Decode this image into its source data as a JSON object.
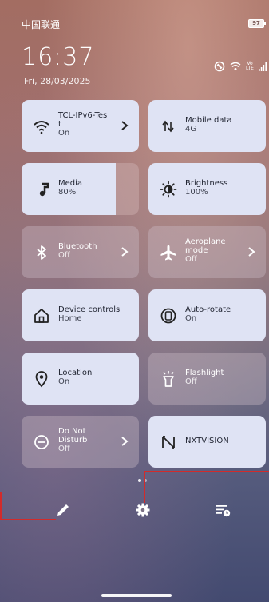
{
  "status_bar": {
    "carrier": "中国联通",
    "battery": "97",
    "volte_label_top": "Vo",
    "volte_label_bottom": "LTE"
  },
  "lockscreen": {
    "time": "16:37",
    "date": "Fri, 28/03/2025"
  },
  "tiles": [
    {
      "id": "wifi",
      "label": "TCL-IPv6-Tes\nt",
      "status": "On",
      "state": "on",
      "icon": "wifi-icon",
      "has_chevron": true
    },
    {
      "id": "mobile-data",
      "label": "Mobile data",
      "status": "4G",
      "state": "on",
      "icon": "mobile-data-icon",
      "has_chevron": false
    },
    {
      "id": "media",
      "label": "Media",
      "status": "80%",
      "state": "slider",
      "icon": "music-note-icon",
      "level": 0.8
    },
    {
      "id": "brightness",
      "label": "Brightness",
      "status": "100%",
      "state": "on",
      "icon": "brightness-icon",
      "level": 1.0
    },
    {
      "id": "bluetooth",
      "label": "Bluetooth",
      "status": "Off",
      "state": "off",
      "icon": "bluetooth-icon",
      "has_chevron": true
    },
    {
      "id": "aeroplane",
      "label": "Aeroplane mode",
      "status": "Off",
      "state": "off",
      "icon": "airplane-icon",
      "has_chevron": true
    },
    {
      "id": "device-controls",
      "label": "Device controls",
      "status": "Home",
      "state": "on",
      "icon": "home-icon"
    },
    {
      "id": "auto-rotate",
      "label": "Auto-rotate",
      "status": "On",
      "state": "on",
      "icon": "rotate-icon"
    },
    {
      "id": "location",
      "label": "Location",
      "status": "On",
      "state": "on",
      "icon": "location-pin-icon"
    },
    {
      "id": "flashlight",
      "label": "Flashlight",
      "status": "Off",
      "state": "off",
      "icon": "flashlight-icon"
    },
    {
      "id": "do-not-disturb",
      "label": "Do Not Disturb",
      "status": "Off",
      "state": "off",
      "icon": "do-not-disturb-icon",
      "has_chevron": true
    },
    {
      "id": "nxtvision",
      "label": "NXTVISION",
      "status": "",
      "state": "on",
      "icon": "nxtvision-icon"
    }
  ],
  "labels": {
    "wifi_l1": "TCL-IPv6-Tes",
    "wifi_l2": "t",
    "wifi_status": "On",
    "mobile_label": "Mobile data",
    "mobile_status": "4G",
    "media_label": "Media",
    "media_status": "80%",
    "brightness_label": "Brightness",
    "brightness_status": "100%",
    "bluetooth_label": "Bluetooth",
    "bluetooth_status": "Off",
    "aeroplane_l1": "Aeroplane",
    "aeroplane_l2": "mode",
    "aeroplane_status": "Off",
    "device_controls_label": "Device controls",
    "device_controls_status": "Home",
    "auto_rotate_label": "Auto-rotate",
    "auto_rotate_status": "On",
    "location_label": "Location",
    "location_status": "On",
    "flashlight_label": "Flashlight",
    "flashlight_status": "Off",
    "dnd_l1": "Do Not",
    "dnd_l2": "Disturb",
    "dnd_status": "Off",
    "nxtvision_label": "NXTVISION"
  },
  "pager": {
    "pages": 2,
    "current": 1
  },
  "bottom_bar": {
    "edit_icon": "pencil-icon",
    "settings_icon": "gear-icon",
    "queue_icon": "list-clock-icon"
  },
  "colors": {
    "tile_on": "#dfe3f4",
    "tile_off": "rgba(205,190,200,0.38)",
    "annotation_red": "#d22b2b"
  }
}
